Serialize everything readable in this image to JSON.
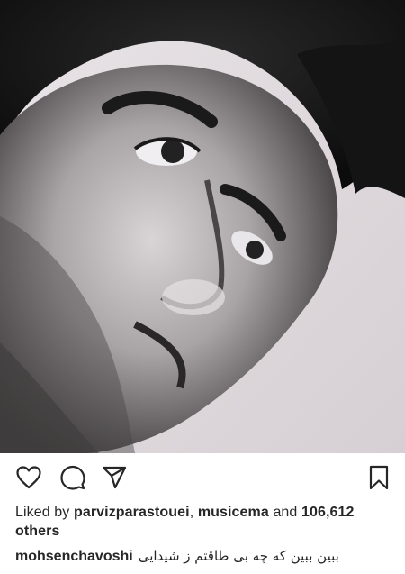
{
  "post": {
    "image_alt": "Black and white close-up portrait photo",
    "liked_by_prefix": "Liked by",
    "liked_user_1": "parvizparastouei",
    "separator": ",",
    "liked_user_2": "musicema",
    "and_word": "and",
    "others_count": "106,612",
    "others_word": "others",
    "author": "mohsenchavoshi",
    "caption": "ببین ببین که چه بی طاقتم ز شیدایی"
  },
  "icons": {
    "like": "heart-outline-icon",
    "comment": "speech-bubble-icon",
    "share": "paper-plane-icon",
    "save": "bookmark-icon"
  },
  "colors": {
    "text": "#262626",
    "background": "#ffffff"
  }
}
